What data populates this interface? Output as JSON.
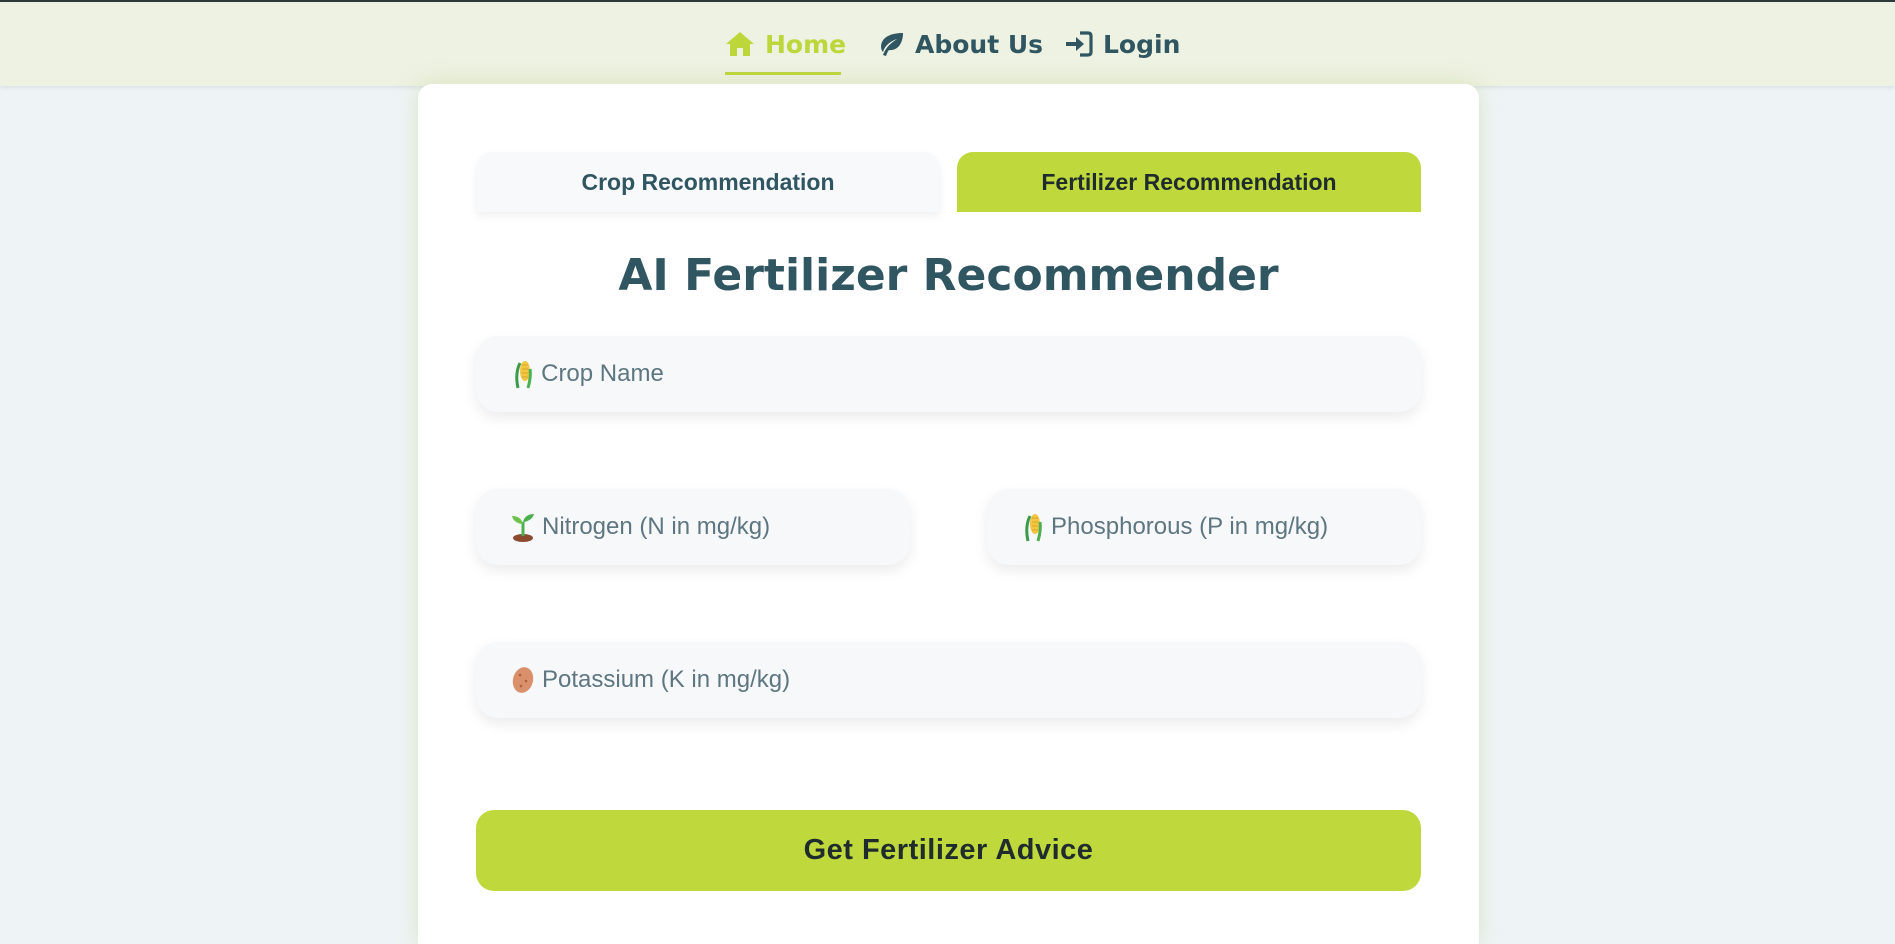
{
  "nav": {
    "home_label": "Home",
    "about_label": "About Us",
    "login_label": "Login"
  },
  "tabs": {
    "crop_label": "Crop Recommendation",
    "fertilizer_label": "Fertilizer Recommendation",
    "active": "fertilizer"
  },
  "form": {
    "title": "AI Fertilizer Recommender",
    "crop_placeholder": "Crop Name",
    "nitrogen_placeholder": "Nitrogen (N in mg/kg)",
    "phosphorous_placeholder": "Phosphorous (P in mg/kg)",
    "potassium_placeholder": "Potassium (K in mg/kg)",
    "submit_label": "Get Fertilizer Advice"
  },
  "icons": {
    "home": "home-icon",
    "about": "leaf-icon",
    "login": "sign-in-icon",
    "crop": "corn-emoji-icon",
    "nitrogen": "seedling-emoji-icon",
    "phosphorous": "corn-emoji-icon",
    "potassium": "potato-emoji-icon"
  },
  "colors": {
    "accent": "#bfd93d",
    "text_dark": "#2f5661",
    "nav_bg": "#edf2e2",
    "page_bg": "#eef4f5"
  }
}
